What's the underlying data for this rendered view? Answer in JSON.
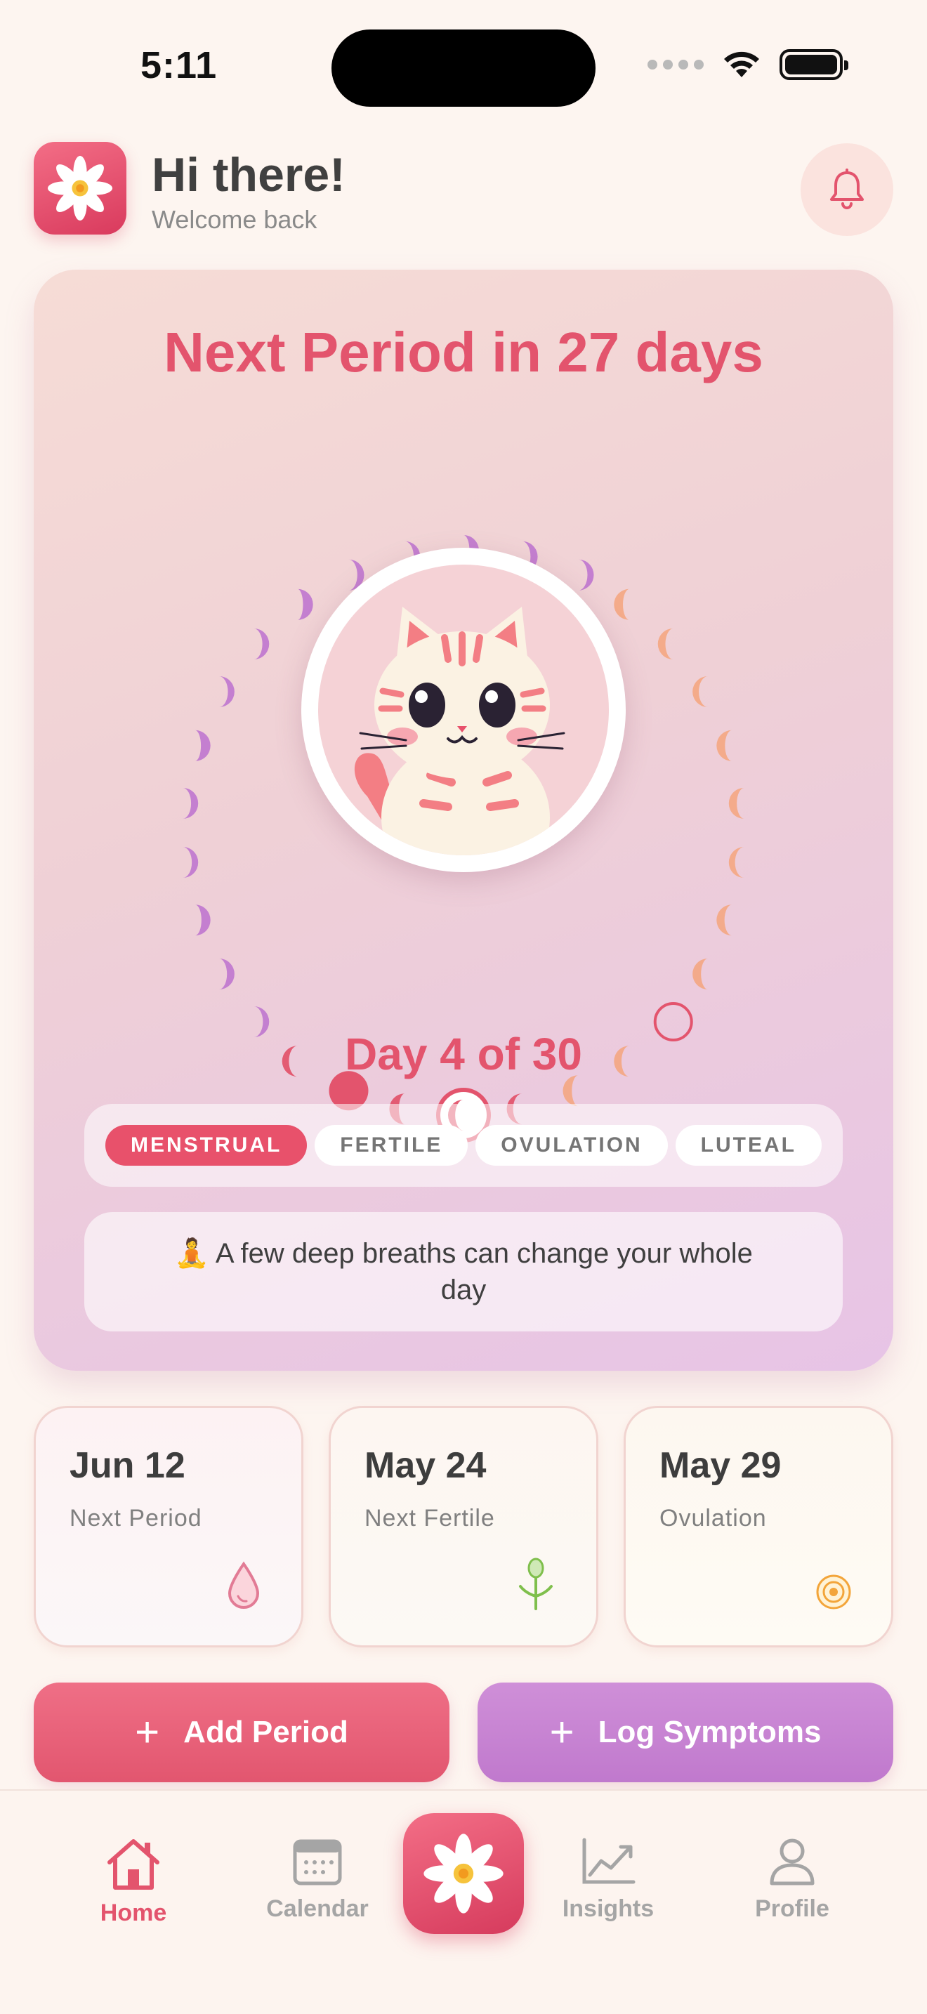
{
  "status_bar": {
    "time": "5:11"
  },
  "header": {
    "greeting": "Hi there!",
    "subtitle": "Welcome back",
    "logo_icon": "flower-icon",
    "notification_icon": "bell-icon"
  },
  "cycle_card": {
    "title": "Next Period in 27 days",
    "current_day": 4,
    "cycle_length": 30,
    "day_label": "Day 4 of 30",
    "phases": [
      {
        "label": "MENSTRUAL",
        "active": true
      },
      {
        "label": "FERTILE",
        "active": false
      },
      {
        "label": "OVULATION",
        "active": false
      },
      {
        "label": "LUTEAL",
        "active": false
      }
    ],
    "tip": "🧘 A few deep breaths can change your whole day",
    "colors": {
      "menstrual": "#e3546d",
      "follicular": "#f4a47c",
      "luteal": "#c17ad0",
      "accent": "#e3546d"
    }
  },
  "date_cards": [
    {
      "date": "Jun 12",
      "caption": "Next Period",
      "icon": "drop-icon"
    },
    {
      "date": "May 24",
      "caption": "Next Fertile",
      "icon": "sprout-icon"
    },
    {
      "date": "May 29",
      "caption": "Ovulation",
      "icon": "target-icon"
    }
  ],
  "actions": {
    "add_period": "Add Period",
    "log_symptoms": "Log Symptoms"
  },
  "tab_bar": {
    "home": "Home",
    "calendar": "Calendar",
    "insights": "Insights",
    "profile": "Profile",
    "active": "Home"
  }
}
